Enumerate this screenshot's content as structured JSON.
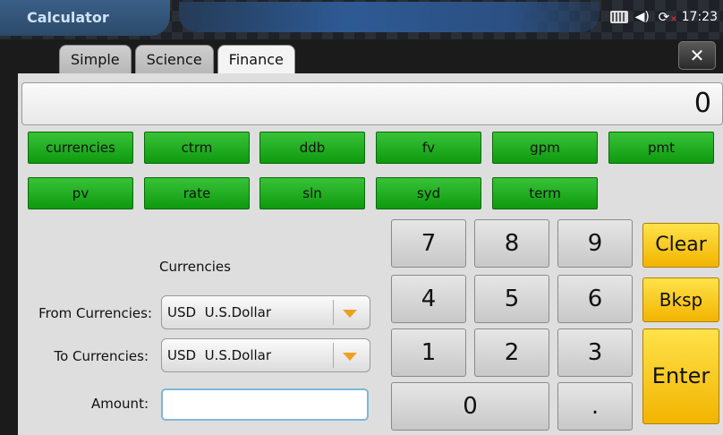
{
  "app": {
    "title": "Calculator",
    "clock": "17:23"
  },
  "tabs": [
    "Simple",
    "Science",
    "Finance"
  ],
  "active_tab": "Finance",
  "close_label": "✕",
  "display": {
    "value": "0"
  },
  "finance_functions": [
    "currencies",
    "ctrm",
    "ddb",
    "fv",
    "gpm",
    "pmt",
    "pv",
    "rate",
    "sln",
    "syd",
    "term"
  ],
  "currency_form": {
    "heading": "Currencies",
    "from_label": "From Currencies:",
    "from_value": "USD  U.S.Dollar",
    "to_label": "To Currencies:",
    "to_value": "USD  U.S.Dollar",
    "amount_label": "Amount:",
    "amount_value": ""
  },
  "keypad": {
    "digits": [
      "7",
      "8",
      "9",
      "4",
      "5",
      "6",
      "1",
      "2",
      "3"
    ],
    "zero": "0",
    "dot": ".",
    "clear": "Clear",
    "bksp": "Bksp",
    "enter": "Enter"
  },
  "colors": {
    "function_button": "#1fae1f",
    "action_button": "#ffd21a",
    "title_text": "#cfe2f7"
  },
  "icons": [
    "keyboard-icon",
    "volume-icon",
    "sync-error-icon"
  ]
}
